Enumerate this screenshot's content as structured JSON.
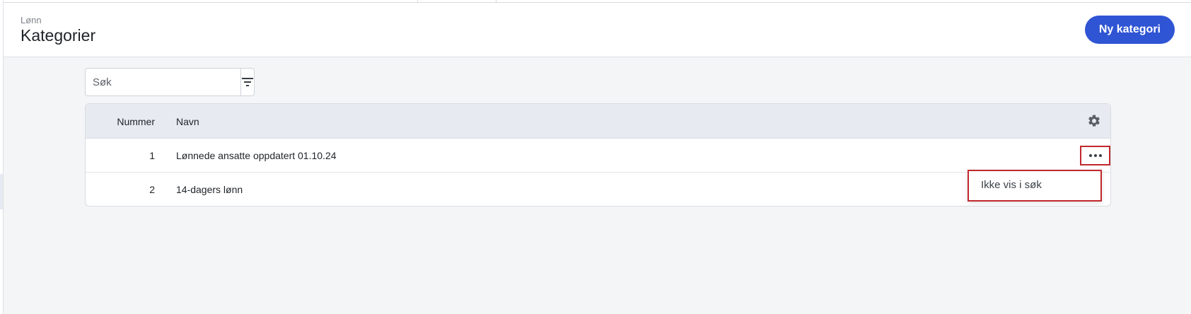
{
  "header": {
    "breadcrumb": "Lønn",
    "title": "Kategorier",
    "new_button_label": "Ny kategori"
  },
  "search": {
    "placeholder": "Søk",
    "value": ""
  },
  "table": {
    "columns": [
      "Nummer",
      "Navn"
    ],
    "rows": [
      {
        "number": "1",
        "name": "Lønnede ansatte oppdatert 01.10.24"
      },
      {
        "number": "2",
        "name": "14-dagers lønn"
      }
    ]
  },
  "row_menu": {
    "items": [
      "Ikke vis i søk"
    ]
  },
  "colors": {
    "primary": "#2f55d4",
    "highlight": "#c0282d",
    "header_bg": "#e7eaf1"
  },
  "icons": {
    "filter": "filter-icon",
    "settings": "gear-icon",
    "more": "more-horizontal-icon"
  }
}
